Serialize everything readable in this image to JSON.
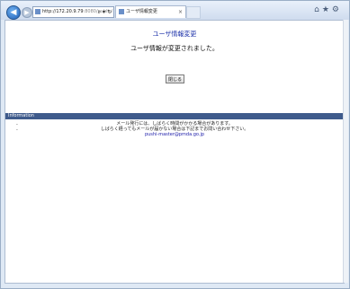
{
  "browser": {
    "address_host": "http://172.20.9.79",
    "address_rest": ":8080/public/",
    "address_controls": "⌕ ▾ ↻",
    "tab_title": "ユーザ情報変更",
    "tab_close": "×"
  },
  "page": {
    "heading": "ユーザ情報変更",
    "message": "ユーザ情報が変更されました。",
    "close_button": "閉じる"
  },
  "information": {
    "title": "Information",
    "lines": [
      "メール発行には、しばらく時間がかかる場合があります。",
      "しばらく経ってもメールが届かない場合は下記までお問い合わせ下さい。"
    ],
    "email": "pushi-master@pmda.go.jp"
  }
}
